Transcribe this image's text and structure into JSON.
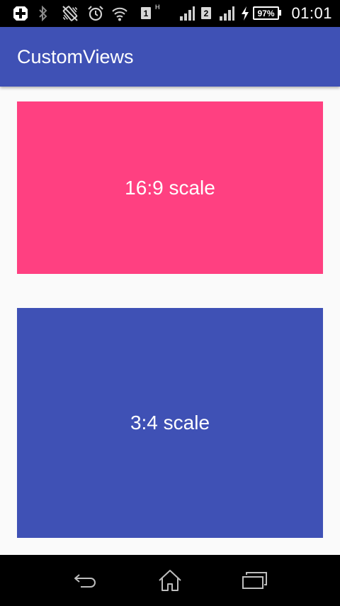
{
  "status_bar": {
    "sim1": "1",
    "sim1_mark": "H",
    "sim2": "2",
    "battery": "97%",
    "time": "01:01",
    "icons": [
      "plus-box-icon",
      "bluetooth-icon",
      "vibrate-icon",
      "alarm-icon",
      "wifi-icon",
      "signal-icon",
      "signal-icon",
      "charging-icon"
    ]
  },
  "app_bar": {
    "title": "CustomViews",
    "color": "#3f51b5"
  },
  "main": {
    "panels": [
      {
        "label": "16:9 scale",
        "color": "#ff4081"
      },
      {
        "label": "3:4 scale",
        "color": "#3f51b5"
      }
    ]
  },
  "nav_bar": {
    "buttons": [
      "back-icon",
      "home-icon",
      "recents-icon"
    ]
  }
}
